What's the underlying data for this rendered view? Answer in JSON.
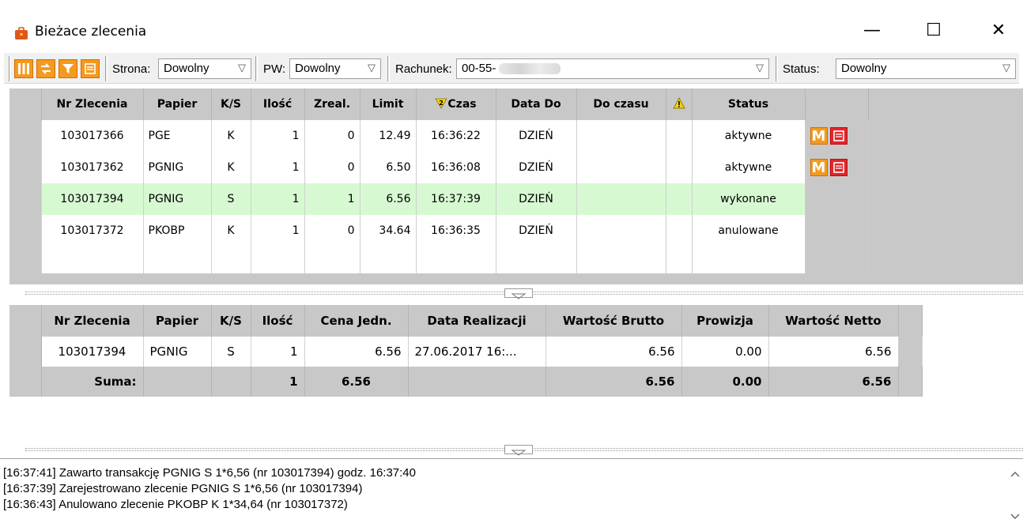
{
  "window": {
    "title": "Bieżace zlecenia"
  },
  "toolbar": {
    "strona_label": "Strona:",
    "strona_value": "Dowolny",
    "pw_label": "PW:",
    "pw_value": "Dowolny",
    "rachunek_label": "Rachunek:",
    "rachunek_value": "00-55-",
    "status_label": "Status:",
    "status_value": "Dowolny"
  },
  "orders": {
    "headers": [
      "Nr Zlecenia",
      "Papier",
      "K/S",
      "Ilość",
      "Zreal.",
      "Limit",
      "Czas",
      "Data Do",
      "Do czasu",
      "",
      "Status"
    ],
    "sort_badge": "2",
    "rows": [
      {
        "nr": "103017366",
        "papier": "PGE",
        "ks": "K",
        "ilosc": "1",
        "zreal": "0",
        "limit": "12.49",
        "czas": "16:36:22",
        "data_do": "DZIEŃ",
        "do_czasu": "",
        "status": "aktywne",
        "actions": true
      },
      {
        "nr": "103017362",
        "papier": "PGNIG",
        "ks": "K",
        "ilosc": "1",
        "zreal": "0",
        "limit": "6.50",
        "czas": "16:36:08",
        "data_do": "DZIEŃ",
        "do_czasu": "",
        "status": "aktywne",
        "actions": true
      },
      {
        "nr": "103017394",
        "papier": "PGNIG",
        "ks": "S",
        "ilosc": "1",
        "zreal": "1",
        "limit": "6.56",
        "czas": "16:37:39",
        "data_do": "DZIEŃ",
        "do_czasu": "",
        "status": "wykonane",
        "actions": false
      },
      {
        "nr": "103017372",
        "papier": "PKOBP",
        "ks": "K",
        "ilosc": "1",
        "zreal": "0",
        "limit": "34.64",
        "czas": "16:36:35",
        "data_do": "DZIEŃ",
        "do_czasu": "",
        "status": "anulowane",
        "actions": false
      }
    ],
    "action_m_label": "M"
  },
  "transactions": {
    "headers": [
      "Nr Zlecenia",
      "Papier",
      "K/S",
      "Ilość",
      "Cena Jedn.",
      "Data Realizacji",
      "Wartość Brutto",
      "Prowizja",
      "Wartość Netto"
    ],
    "rows": [
      {
        "nr": "103017394",
        "papier": "PGNIG",
        "ks": "S",
        "ilosc": "1",
        "cena": "6.56",
        "data": "27.06.2017 16:...",
        "brutto": "6.56",
        "prowizja": "0.00",
        "netto": "6.56"
      }
    ],
    "sum": {
      "label": "Suma:",
      "ilosc": "1",
      "cena": "6.56",
      "brutto": "6.56",
      "prowizja": "0.00",
      "netto": "6.56"
    }
  },
  "log": {
    "lines": [
      "[16:37:41] Zawarto transakcję PGNIG S 1*6,56  (nr 103017394) godz. 16:37:40",
      "[16:37:39] Zarejestrowano zlecenie PGNIG S 1*6,56  (nr 103017394)",
      "[16:36:43] Anulowano zlecenie PKOBP K 1*34,64  (nr 103017372)"
    ]
  },
  "colors": {
    "accent": "#f49a1e",
    "cancel": "#e2262c",
    "selected_row": "#d7f9d2",
    "grid_gray": "#c8c8c8"
  }
}
